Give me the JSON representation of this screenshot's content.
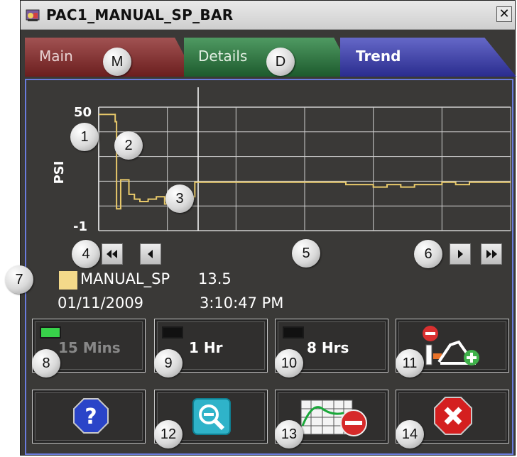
{
  "window": {
    "title": "PAC1_MANUAL_SP_BAR",
    "close_label": "✕"
  },
  "tabs": [
    {
      "label": "Main",
      "callout": "M"
    },
    {
      "label": "Details",
      "callout": "D"
    },
    {
      "label": "Trend"
    }
  ],
  "chart_data": {
    "type": "line",
    "ylabel": "PSI",
    "ylim": [
      -1,
      50
    ],
    "y_tick_labels": [
      "50",
      "-1"
    ],
    "grid": true,
    "series": [
      {
        "color": "#e8c96a",
        "x": [
          0,
          1.1,
          1.2,
          1.3,
          1.6,
          1.8,
          2.2,
          2.6,
          3.0,
          3.6,
          4.2,
          4.8,
          5.2,
          5.6,
          5.7,
          6.0,
          6.6,
          6.9,
          7.0,
          7.4,
          7.8,
          8.4,
          9.0,
          10.0,
          11.0,
          12.0,
          13.0,
          14.0,
          15.0,
          16.0,
          17.0,
          18.0,
          19.0,
          20.0,
          21.0,
          22.0,
          23.0,
          24.0,
          25.0,
          26.0,
          27.0,
          28.0,
          29.5
        ],
        "y": [
          47,
          47,
          44,
          8,
          20,
          20,
          14,
          12,
          11,
          12,
          13,
          10,
          11,
          11,
          14,
          12,
          12,
          13,
          19,
          19,
          19,
          19,
          19,
          19,
          19,
          19,
          19,
          19,
          19,
          19,
          19,
          18,
          18,
          17,
          18,
          17,
          18,
          18,
          19,
          18,
          19,
          19,
          19
        ]
      }
    ]
  },
  "callouts": {
    "c1": "1",
    "c2": "2",
    "c3": "3",
    "c4": "4",
    "c5": "5",
    "c6": "6",
    "c7": "7",
    "c8": "8",
    "c9": "9",
    "c10": "10",
    "c11": "11",
    "c12": "12",
    "c13": "13",
    "c14": "14"
  },
  "legend": {
    "series_name": "MANUAL_SP",
    "value": "13.5",
    "swatch_color": "#f3d98a"
  },
  "datetime": {
    "date": "01/11/2009",
    "time": "3:10:47 PM"
  },
  "buttons": {
    "b15": {
      "label": "15 Mins",
      "active": true
    },
    "b1": {
      "label": "1 Hr",
      "active": false
    },
    "b8": {
      "label": "8 Hrs",
      "active": false
    }
  },
  "icons": {
    "app": "faceplate-app-icon",
    "nav_first": "double-left-arrow-icon",
    "nav_prev": "left-arrow-icon",
    "nav_next": "right-arrow-icon",
    "nav_last": "double-right-arrow-icon",
    "pens": "add-remove-pen-icon",
    "help": "help-icon",
    "zoom": "zoom-out-icon",
    "remove_trend": "remove-trend-icon",
    "close_faceplate": "close-icon"
  }
}
